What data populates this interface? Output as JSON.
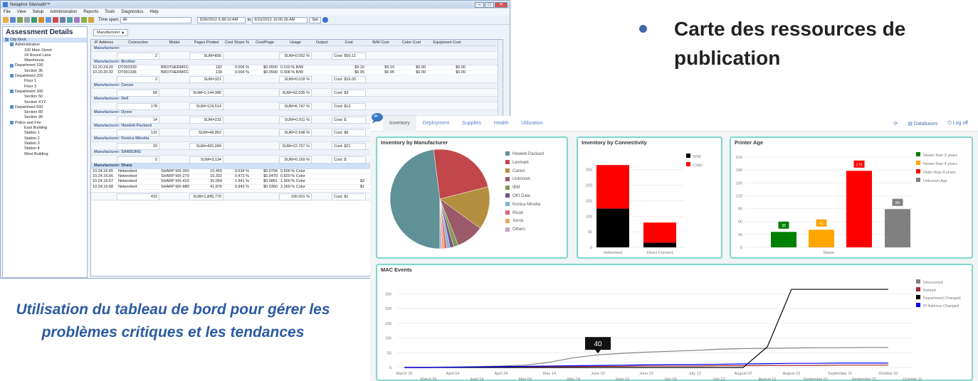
{
  "window": {
    "title": "Netaphor SiteAudit™",
    "menus": [
      "File",
      "View",
      "Setup",
      "Administration",
      "Reports",
      "Tools",
      "Diagnostics",
      "Help"
    ],
    "timespan_label": "Time span:",
    "timespan_value": "All",
    "from_date": "3/30/2012  6:38:10 AM",
    "to_label": "to",
    "to_date": "6/15/2012 10:00:36 AM",
    "set_button": "Set"
  },
  "side_panel": {
    "header": "Assessment Details",
    "tree": [
      {
        "label": "City Govt",
        "level": 0
      },
      {
        "label": "Administration",
        "level": 1
      },
      {
        "label": "100 Main Street",
        "level": 2
      },
      {
        "label": "24 Round Lane",
        "level": 2
      },
      {
        "label": "Warehouse",
        "level": 2
      },
      {
        "label": "Department 100",
        "level": 1
      },
      {
        "label": "Section 35",
        "level": 2
      },
      {
        "label": "Department 200",
        "level": 1
      },
      {
        "label": "Floor 1",
        "level": 2
      },
      {
        "label": "Floor 3",
        "level": 2
      },
      {
        "label": "Department 300",
        "level": 1
      },
      {
        "label": "Section 50",
        "level": 2
      },
      {
        "label": "Section XYZ",
        "level": 2
      },
      {
        "label": "Department 500",
        "level": 1
      },
      {
        "label": "Section 89",
        "level": 2
      },
      {
        "label": "Section 99",
        "level": 2
      },
      {
        "label": "Police and Fire",
        "level": 1
      },
      {
        "label": "East Building",
        "level": 2
      },
      {
        "label": "Station 1",
        "level": 2
      },
      {
        "label": "Station 2",
        "level": 2
      },
      {
        "label": "Station 3",
        "level": 2
      },
      {
        "label": "Station 4",
        "level": 2
      },
      {
        "label": "West Building",
        "level": 2
      }
    ]
  },
  "grid": {
    "group_chip": "Manufacturer ▲",
    "columns": [
      "IP Address",
      "Connection",
      "Model",
      "Pages Printed",
      "Cost Share %",
      "Cost/Page",
      "Usage",
      "Output",
      "Cost",
      "B/W Cost",
      "Color Cost",
      "Equipment Cost"
    ],
    "sections": [
      {
        "title": "Manufacturer:",
        "rows": [],
        "sum": {
          "connection": "2",
          "pages": "SUM=856",
          "usage": "SUM=0.052 %",
          "cost": "Cost: $50.11"
        }
      },
      {
        "title": "Manufacturer: Brother",
        "rows": [
          [
            "10.20.24.20",
            "DT093330",
            "BROTHERMFC-...",
            "182",
            "0.006 %",
            "$0.0500",
            "0.010 % B/W",
            "",
            "$9.10",
            "$9.10",
            "$0.00",
            "$0.00"
          ],
          [
            "10.20.20.32",
            "DT091336",
            "BROTHERMFC-...",
            "139",
            "0.004 %",
            "$0.0500",
            "0.008 % B/W",
            "",
            "$6.95",
            "$6.95",
            "$0.00",
            "$0.00"
          ]
        ],
        "sum": {
          "connection": "2",
          "pages": "SUM=321",
          "usage": "SUM=0.018 %",
          "cost": "Cost: $16.05"
        }
      },
      {
        "title": "Manufacturer: Canon",
        "rows": [],
        "sum": {
          "connection": "68",
          "pages": "SUM=1,144,986",
          "usage": "SUM=62.035 %",
          "cost": "Cost: $3"
        }
      },
      {
        "title": "Manufacturer: Dell",
        "rows": [],
        "sum": {
          "connection": "178",
          "pages": "SUM=124,514",
          "usage": "SUM=6.747 %",
          "cost": "Cost: $12"
        }
      },
      {
        "title": "Manufacturer: Dymo",
        "rows": [],
        "sum": {
          "connection": "14",
          "pages": "SUM=231",
          "usage": "SUM=0.011 %",
          "cost": "Cost: $"
        }
      },
      {
        "title": "Manufacturer: Hewlett-Packard",
        "rows": [],
        "sum": {
          "connection": "131",
          "pages": "SUM=48,852",
          "usage": "SUM=2.648 %",
          "cost": "Cost: $6"
        }
      },
      {
        "title": "Manufacturer: Konica Minolta",
        "rows": [],
        "sum": {
          "connection": "29",
          "pages": "SUM=420,084",
          "usage": "SUM=22.757 %",
          "cost": "Cost: $21"
        }
      },
      {
        "title": "Manufacturer: SAMSUNG",
        "rows": [],
        "sum": {
          "connection": "5",
          "pages": "SUM=3,134",
          "usage": "SUM=0.169 %",
          "cost": "Cost: $"
        }
      },
      {
        "title": "Manufacturer: Sharp",
        "highlight": true,
        "rows": [
          [
            "10.24.16.65",
            "Networked",
            "SHARP MX-3501N",
            "10,450",
            "0.534 %",
            "$0.0794",
            "0.566 % Color",
            "",
            "",
            "",
            "",
            ""
          ],
          [
            "10.24.16.66",
            "Networked",
            "SHARP MX-2700N",
            "15,302",
            "0.472 %",
            "$0.0479",
            "0.829 % Color",
            "",
            "",
            "",
            "",
            ""
          ],
          [
            "10.24.16.67",
            "Networked",
            "SHARP MX-4101N",
            "35,064",
            "1.941 %",
            "$0.0861",
            "1.900 % Color",
            "",
            "$3",
            "",
            "",
            ""
          ],
          [
            "10.24.16.68",
            "Networked",
            "SHARP MX-M850",
            "41,876",
            "0.943 %",
            "$0.0350",
            "2.269 % Color",
            "",
            "$1",
            "",
            "",
            ""
          ]
        ],
        "sum": null
      }
    ],
    "total": {
      "connection": "433",
      "pages": "SUM=1,845,770",
      "usage": "100.001 %",
      "cost": "Cost: $1"
    }
  },
  "bullet": {
    "text": "Carte des ressources de publication"
  },
  "caption": {
    "text": "Utilisation du tableau de bord pour gérer les problèmes critiques et les tendances"
  },
  "dashboard": {
    "tabs": [
      "Inventory",
      "Deployment",
      "Supplies",
      "Health",
      "Utilization"
    ],
    "active_tab": "Inventory",
    "databases": "Databases",
    "logoff": "Log off",
    "refresh_icon": "refresh-icon"
  },
  "chart_data": [
    {
      "type": "pie",
      "title": "Inventory by Manufacturer",
      "categories": [
        "Hewlett-Packard",
        "Lexmark",
        "Canon",
        "Unknown",
        "IBM",
        "OKI Data",
        "Konica Minolta",
        "Ricoh",
        "Xerox",
        "Others"
      ],
      "values": [
        48,
        23,
        14,
        9,
        1.5,
        1.2,
        1,
        0.9,
        0.7,
        0.7
      ],
      "colors": [
        "#5f9196",
        "#c2474a",
        "#b38f3f",
        "#9a5a6a",
        "#7d9a52",
        "#7a4f86",
        "#7fb6cd",
        "#d9677b",
        "#e7a65a",
        "#c9a3cf"
      ],
      "legend": "right"
    },
    {
      "type": "bar",
      "title": "Inventory by Connectivity",
      "categories": [
        "Networked",
        "Direct Connect"
      ],
      "series": [
        {
          "name": "B/W",
          "values": [
            125,
            15
          ]
        },
        {
          "name": "Color",
          "values": [
            140,
            65
          ]
        }
      ],
      "stacked": true,
      "colors": [
        "#000000",
        "#ff0000"
      ],
      "ylim": [
        0,
        270
      ],
      "yticks": [
        0,
        50,
        100,
        150,
        200,
        250
      ],
      "legend": "top-right"
    },
    {
      "type": "bar",
      "title": "Printer Age",
      "categories": [
        "Newer than 3 years",
        "Newer than 4 years",
        "Older than 4 years",
        "Unknown Age"
      ],
      "values": [
        36,
        41,
        178,
        89
      ],
      "colors": [
        "#008000",
        "#ffa500",
        "#ff0000",
        "#808080"
      ],
      "xlabel": "Status",
      "ylim": [
        0,
        215
      ],
      "yticks": [
        0,
        30,
        60,
        90,
        120,
        150,
        180,
        210
      ],
      "legend": "top-right"
    },
    {
      "type": "line",
      "title": "MAC Events",
      "x": [
        "March 15",
        "March 25",
        "April 04",
        "April 14",
        "April 24",
        "May 04",
        "May 14",
        "May 24",
        "June 03",
        "June 13",
        "June 23",
        "July 03",
        "July 13",
        "July 23",
        "August 02",
        "August 12",
        "August 22",
        "September 01",
        "September 11",
        "September 21",
        "October 01",
        "October 11"
      ],
      "series": [
        {
          "name": "Discovered",
          "color": "#808080",
          "values": [
            0,
            1,
            2,
            3,
            5,
            8,
            18,
            33,
            43,
            48,
            52,
            55,
            58,
            62,
            64,
            65,
            66,
            67,
            67,
            68,
            68,
            null
          ]
        },
        {
          "name": "Retired",
          "color": "#a52a2a",
          "values": [
            0,
            0,
            1,
            1,
            2,
            2,
            3,
            3,
            4,
            4,
            5,
            5,
            5,
            6,
            6,
            7,
            7,
            7,
            8,
            8,
            8,
            null
          ]
        },
        {
          "name": "Department Changed",
          "color": "#000000",
          "values": [
            0,
            0,
            0,
            0,
            0,
            0,
            0,
            0,
            0,
            0,
            0,
            0,
            0,
            0,
            0,
            70,
            265,
            265,
            265,
            265,
            265,
            null
          ]
        },
        {
          "name": "IP Address Changed",
          "color": "#0000ff",
          "values": [
            0,
            0,
            1,
            2,
            3,
            4,
            5,
            6,
            7,
            8,
            9,
            10,
            10,
            11,
            12,
            13,
            14,
            14,
            15,
            15,
            15,
            null
          ]
        }
      ],
      "annotation": "40",
      "ylim": [
        0,
        270
      ],
      "yticks": [
        0,
        50,
        100,
        150,
        200,
        250
      ],
      "legend": "top-right"
    }
  ]
}
